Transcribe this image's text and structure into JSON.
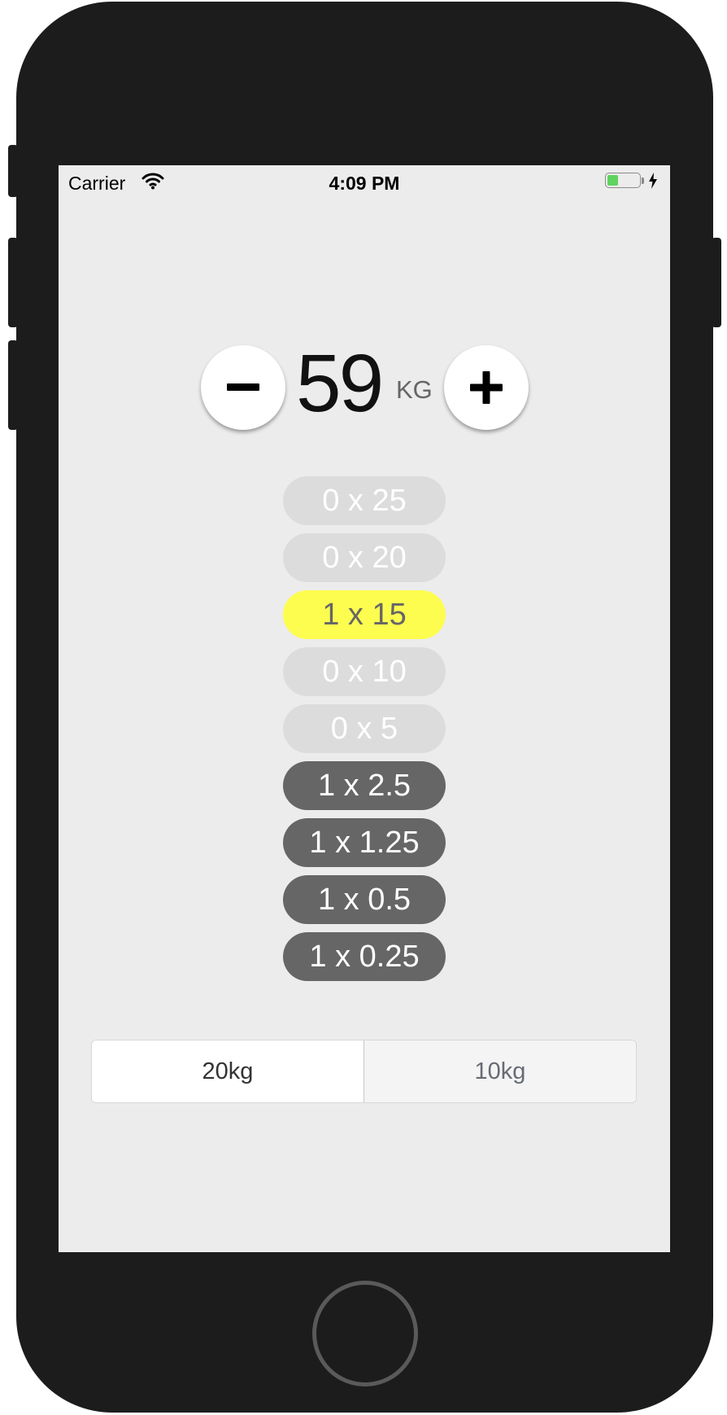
{
  "status_bar": {
    "carrier": "Carrier",
    "time": "4:09 PM",
    "battery_level": 0.35,
    "battery_color": "#5fd35f"
  },
  "icons": {
    "wifi": "wifi-icon",
    "battery": "battery-icon",
    "charging": "charging-bolt-icon",
    "minus": "minus-icon",
    "plus": "plus-icon",
    "home": "home-button"
  },
  "weight": {
    "value": "59",
    "unit": "KG"
  },
  "plates": [
    {
      "label": "0 x 25",
      "state": "off"
    },
    {
      "label": "0 x 20",
      "state": "off"
    },
    {
      "label": "1 x 15",
      "state": "selected"
    },
    {
      "label": "0 x 10",
      "state": "off"
    },
    {
      "label": "0 x 5",
      "state": "off"
    },
    {
      "label": "1 x 2.5",
      "state": "on"
    },
    {
      "label": "1 x 1.25",
      "state": "on"
    },
    {
      "label": "1 x 0.5",
      "state": "on"
    },
    {
      "label": "1 x 0.25",
      "state": "on"
    }
  ],
  "bar_selector": {
    "options": [
      "20kg",
      "10kg"
    ],
    "selected": "20kg"
  },
  "colors": {
    "selected_plate": "#fdfd50",
    "active_plate": "#666666",
    "inactive_plate": "#dcdcdc",
    "background": "#ececec"
  }
}
